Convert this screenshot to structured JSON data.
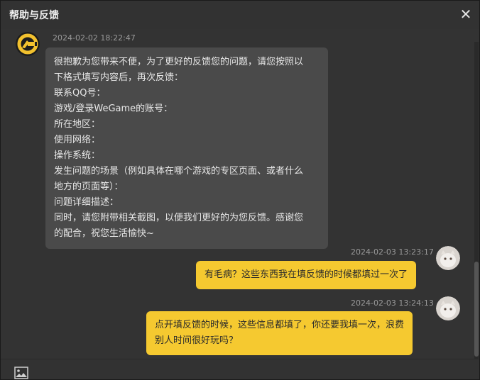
{
  "window": {
    "title": "帮助与反馈",
    "close_glyph": "✕"
  },
  "messages": [
    {
      "side": "left",
      "timestamp": "2024-02-02 18:22:47",
      "lines": [
        "很抱歉为您带来不便，为了更好的反馈您的问题，请您按照以",
        "下格式填写内容后，再次反馈：",
        "联系QQ号：",
        "游戏/登录WeGame的账号：",
        "所在地区：",
        "使用网络：",
        "操作系统：",
        "发生问题的场景（例如具体在哪个游戏的专区页面、或者什么",
        "地方的页面等）：",
        "问题详细描述：",
        "同时，请您附带相关截图，以便我们更好的为您反馈。感谢您",
        "的配合，祝您生活愉快~"
      ]
    },
    {
      "side": "right",
      "timestamp": "2024-02-03 13:23:17",
      "lines": [
        "有毛病？这些东西我在填反馈的时候都填过一次了"
      ]
    },
    {
      "side": "right",
      "timestamp": "2024-02-03 13:24:13",
      "lines": [
        "点开填反馈的时候，这些信息都填了，你还要我填一次，浪费",
        "别人时间很好玩吗？"
      ]
    }
  ],
  "toolbar": {
    "image_icon": "image-icon"
  },
  "colors": {
    "accent_bubble": "#f5c930",
    "incoming_bubble": "#4a4a4a",
    "background": "#333333"
  }
}
